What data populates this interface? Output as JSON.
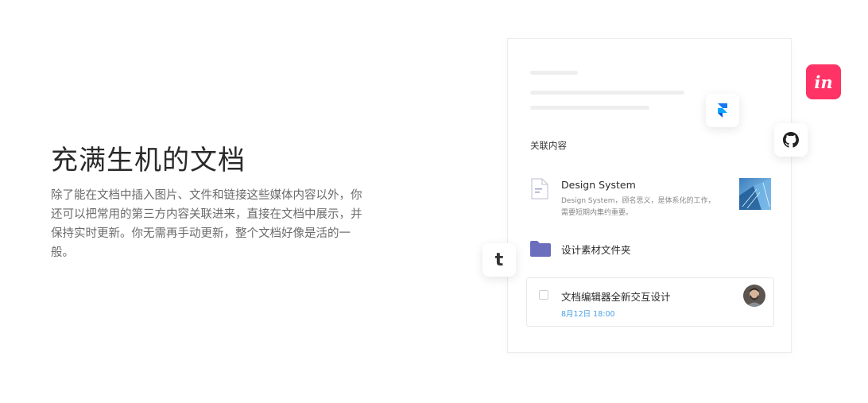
{
  "hero": {
    "title": "充满生机的文档",
    "description": "除了能在文档中插入图片、文件和链接这些媒体内容以外，你还可以把常用的第三方内容关联进来，直接在文档中展示，并保持实时更新。你无需再手动更新，整个文档好像是活的一般。"
  },
  "card": {
    "related_title": "关联内容",
    "document": {
      "title": "Design System",
      "description": "Design System，顾名思义，是体系化的工作，需要短期内集约重要。"
    },
    "folder": {
      "label": "设计素材文件夹"
    },
    "task": {
      "title": "文档编辑器全新交互设计",
      "date": "8月12日 18:00"
    }
  },
  "integrations": {
    "invision_label": "in",
    "tumblr_label": "t"
  },
  "colors": {
    "invision": "#ff3366",
    "folder": "#6b6ebd",
    "date": "#4aa0e6",
    "framer": "#1877f2"
  }
}
